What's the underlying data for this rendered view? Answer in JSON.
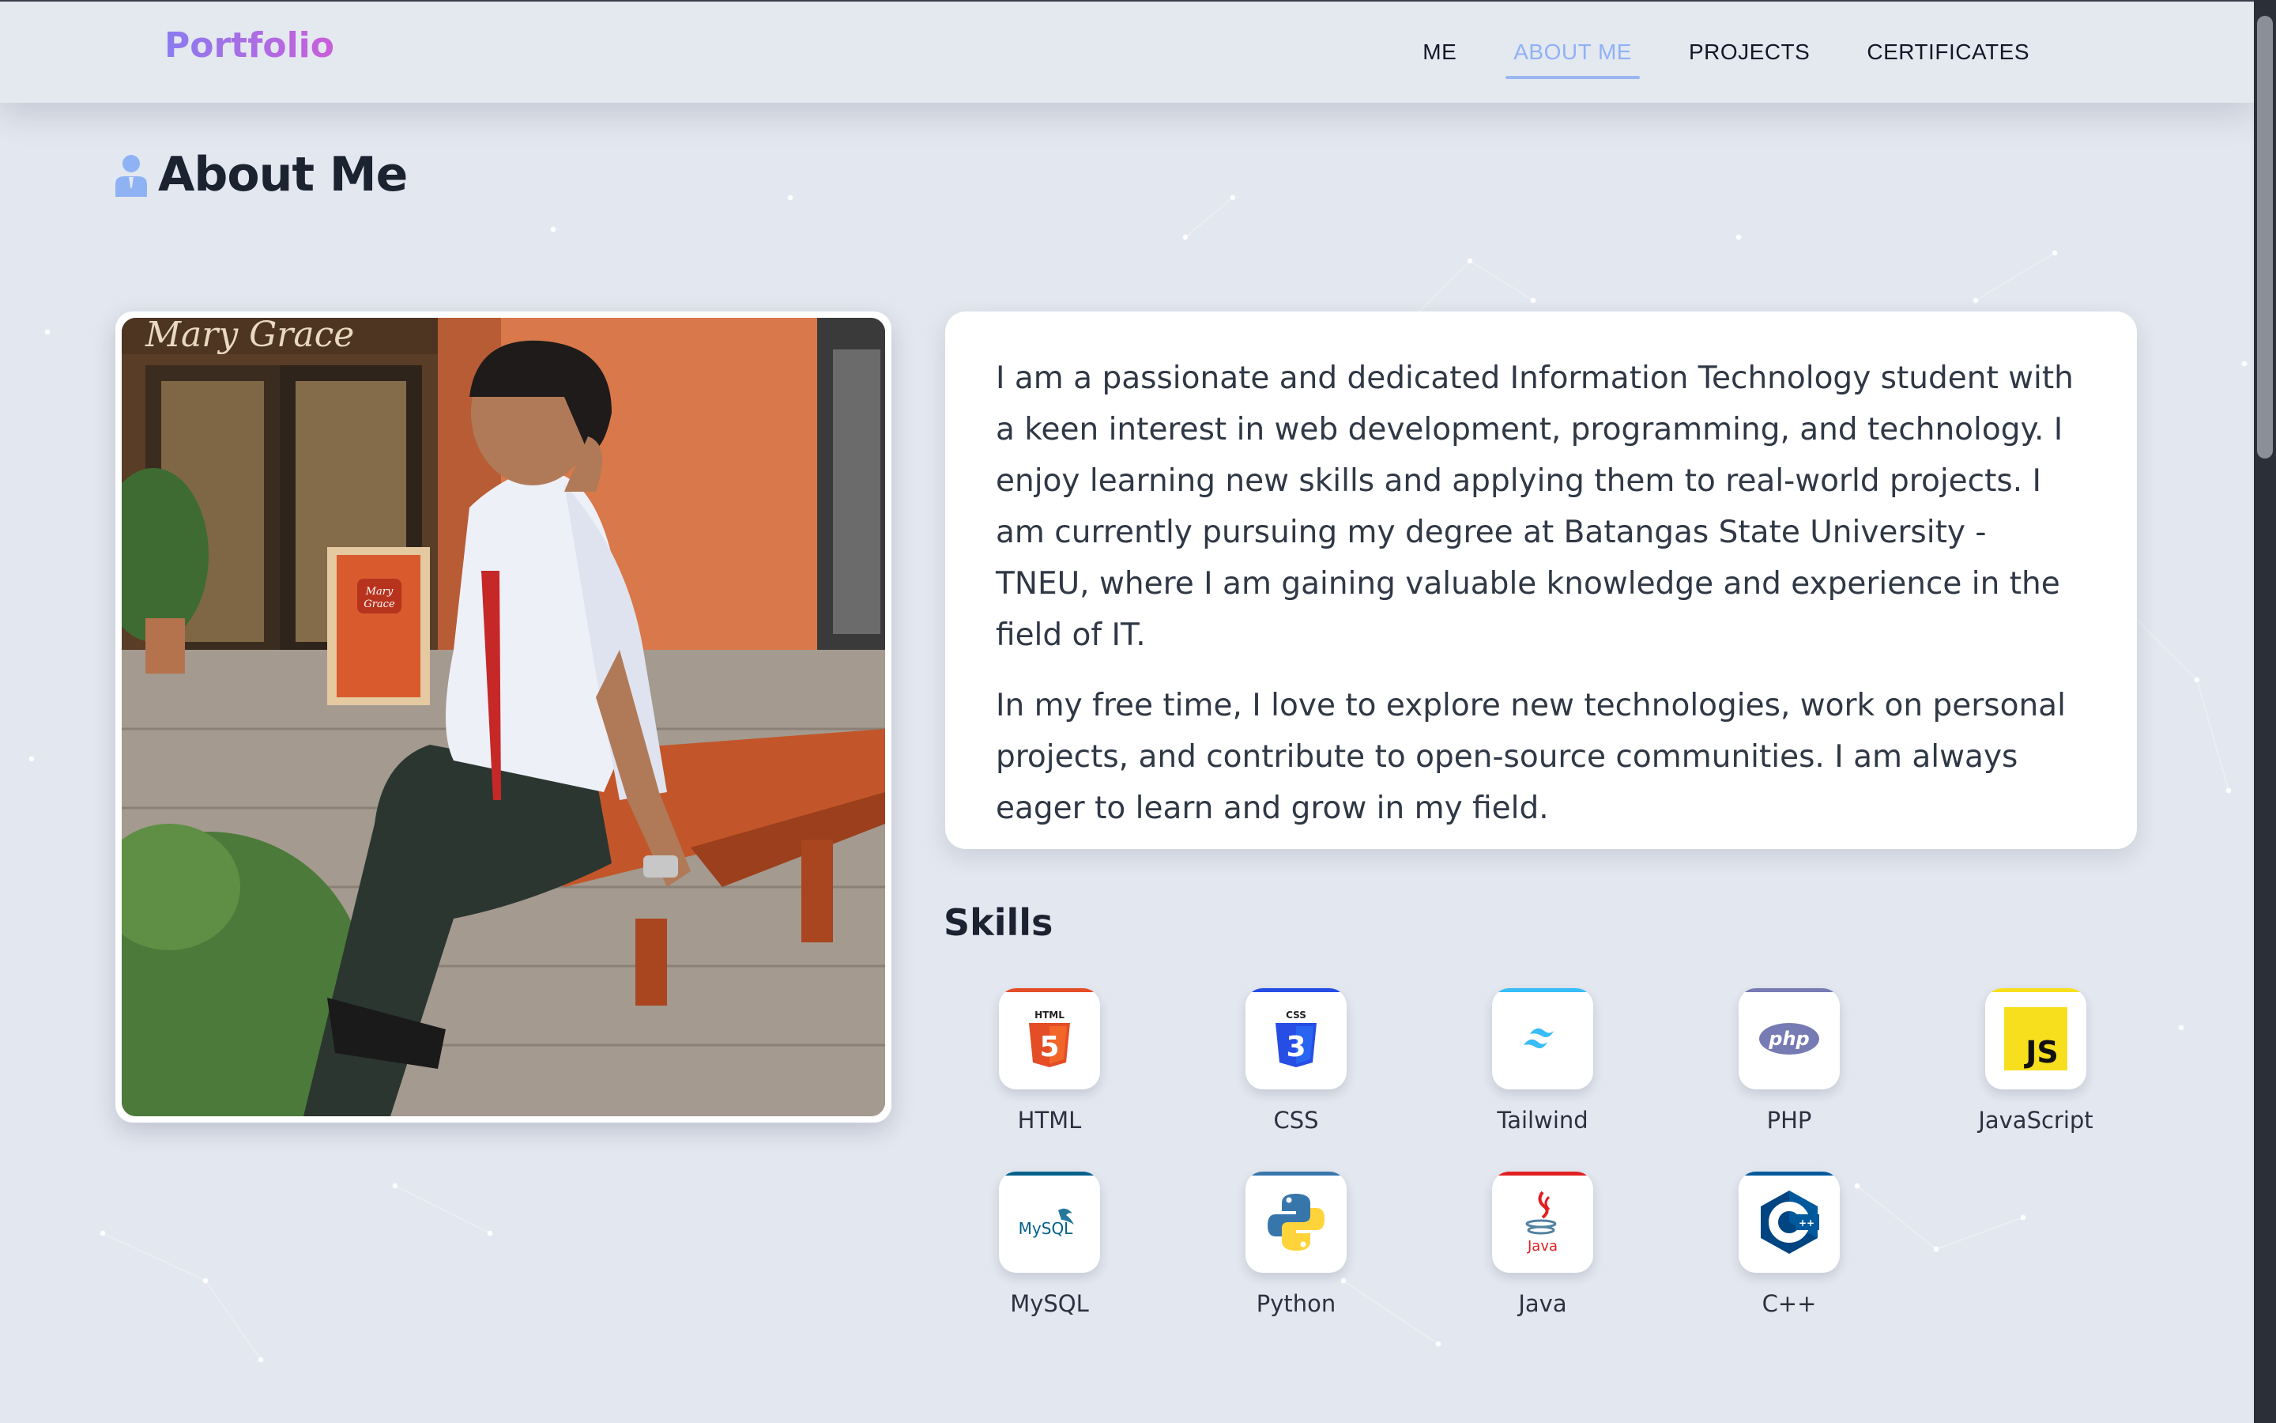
{
  "brand": "Portfolio",
  "nav": {
    "items": [
      {
        "label": "ME",
        "active": false
      },
      {
        "label": "ABOUT ME",
        "active": true
      },
      {
        "label": "PROJECTS",
        "active": false
      },
      {
        "label": "CERTIFICATES",
        "active": false
      }
    ]
  },
  "section": {
    "title": "About Me",
    "title_icon": "user-icon"
  },
  "photo": {
    "alt": "profile-photo",
    "sign_text": "Mary Grace",
    "podium_text": "Mary Grace"
  },
  "bio": {
    "paragraphs": [
      "I am a passionate and dedicated Information Technology student with a keen interest in web development, programming, and technology. I enjoy learning new skills and applying them to real-world projects. I am currently pursuing my degree at Batangas State University - TNEU, where I am gaining valuable knowledge and experience in the field of IT.",
      "In my free time, I love to explore new technologies, work on personal projects, and contribute to open-source communities. I am always eager to learn and grow in my field."
    ]
  },
  "skills": {
    "title": "Skills",
    "items": [
      {
        "name": "HTML",
        "icon": "html5-icon",
        "badge": "HTML",
        "accent": "#e44d26"
      },
      {
        "name": "CSS",
        "icon": "css3-icon",
        "badge": "CSS",
        "accent": "#264de4"
      },
      {
        "name": "Tailwind",
        "icon": "tailwind-icon",
        "accent": "#38bdf8"
      },
      {
        "name": "PHP",
        "icon": "php-icon",
        "badge": "php",
        "accent": "#777bb3"
      },
      {
        "name": "JavaScript",
        "icon": "javascript-icon",
        "badge": "JS",
        "accent": "#f7df1e"
      },
      {
        "name": "MySQL",
        "icon": "mysql-icon",
        "badge": "MySQL",
        "accent": "#00618a"
      },
      {
        "name": "Python",
        "icon": "python-icon",
        "accent": "#3776ab"
      },
      {
        "name": "Java",
        "icon": "java-icon",
        "badge": "Java",
        "accent": "#e11f21"
      },
      {
        "name": "C++",
        "icon": "cpp-icon",
        "badge": "C++",
        "accent": "#00599c"
      }
    ]
  },
  "colors": {
    "background": "#e3e7ef",
    "nav_active": "#8fb2f5",
    "brand_gradient": [
      "#8a7cf0",
      "#c95fd8"
    ],
    "heading": "#1b2230"
  }
}
